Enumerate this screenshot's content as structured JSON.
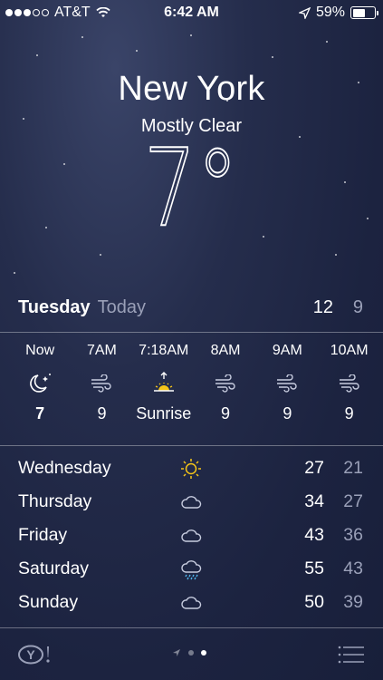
{
  "status_bar": {
    "carrier": "AT&T",
    "time": "6:42 AM",
    "battery_percent": "59%",
    "battery_level": 0.59,
    "signal_bars_filled": 3,
    "signal_bars_total": 5
  },
  "location": {
    "city": "New York",
    "condition": "Mostly Clear",
    "temperature": "7°"
  },
  "today": {
    "day": "Tuesday",
    "label": "Today",
    "high": "12",
    "low": "9"
  },
  "hourly": [
    {
      "time": "Now",
      "icon": "moon-stars-icon",
      "value": "7"
    },
    {
      "time": "7AM",
      "icon": "wind-icon",
      "value": "9"
    },
    {
      "time": "7:18AM",
      "icon": "sunrise-icon",
      "value": "Sunrise"
    },
    {
      "time": "8AM",
      "icon": "wind-icon",
      "value": "9"
    },
    {
      "time": "9AM",
      "icon": "wind-icon",
      "value": "9"
    },
    {
      "time": "10AM",
      "icon": "wind-icon",
      "value": "9"
    }
  ],
  "daily": [
    {
      "day": "Wednesday",
      "icon": "sun-icon",
      "high": "27",
      "low": "21"
    },
    {
      "day": "Thursday",
      "icon": "cloud-icon",
      "high": "34",
      "low": "27"
    },
    {
      "day": "Friday",
      "icon": "cloud-icon",
      "high": "43",
      "low": "36"
    },
    {
      "day": "Saturday",
      "icon": "cloud-rain-icon",
      "high": "55",
      "low": "43"
    },
    {
      "day": "Sunday",
      "icon": "cloud-icon",
      "high": "50",
      "low": "39"
    }
  ],
  "footer": {
    "logo": "Y!",
    "pages": 2,
    "active_page": 2
  },
  "colors": {
    "background": "#1f2644",
    "secondary_text": "#9aa0b8",
    "rain_accent": "#4fb3e8",
    "sun_accent": "#f5c518"
  }
}
